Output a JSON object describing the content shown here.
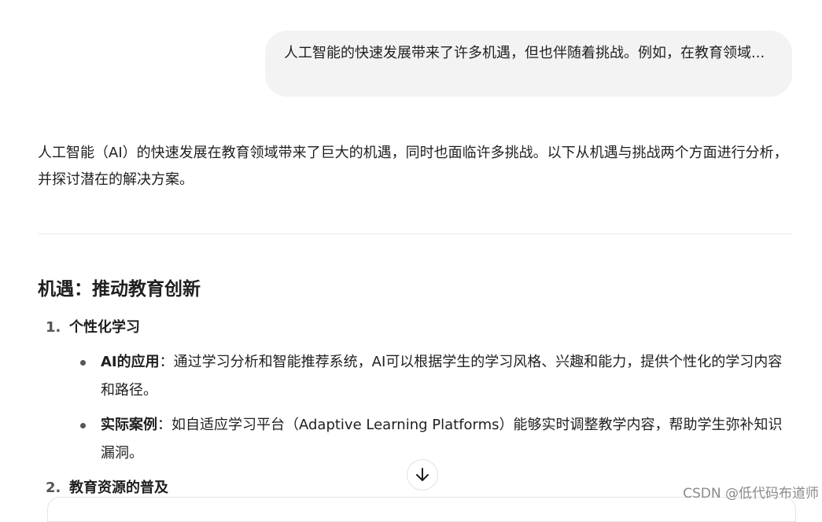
{
  "user_message": "人工智能的快速发展带来了许多机遇，但也伴随着挑战。例如，在教育领域...",
  "assistant": {
    "intro": "人工智能（AI）的快速发展在教育领域带来了巨大的机遇，同时也面临许多挑战。以下从机遇与挑战两个方面进行分析，并探讨潜在的解决方案。",
    "section_heading": "机遇：推动教育创新",
    "items": [
      {
        "number": "1.",
        "title": "个性化学习",
        "bullets": [
          {
            "label": "AI的应用",
            "text": "：通过学习分析和智能推荐系统，AI可以根据学生的学习风格、兴趣和能力，提供个性化的学习内容和路径。"
          },
          {
            "label": "实际案例",
            "text": "：如自适应学习平台（Adaptive Learning Platforms）能够实时调整教学内容，帮助学生弥补知识漏洞。"
          }
        ]
      },
      {
        "number": "2.",
        "title": "教育资源的普及"
      }
    ]
  },
  "scroll_down_icon": "arrow-down-icon",
  "watermark": "CSDN @低代码布道师"
}
